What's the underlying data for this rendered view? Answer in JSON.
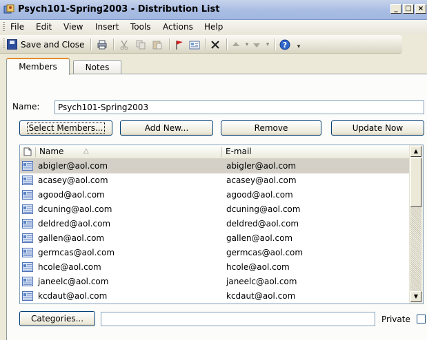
{
  "window": {
    "title": "Psych101-Spring2003 - Distribution List",
    "controls": [
      "_",
      "□",
      "×"
    ]
  },
  "menu": [
    "File",
    "Edit",
    "View",
    "Insert",
    "Tools",
    "Actions",
    "Help"
  ],
  "toolbar": {
    "save_close": "Save and Close",
    "icons": [
      "save-icon",
      "print-icon",
      "cut-icon",
      "copy-icon",
      "paste-icon",
      "flag-icon",
      "address-card-icon",
      "delete-icon",
      "up-arrow-icon",
      "down-arrow-icon",
      "help-icon"
    ]
  },
  "tabs": [
    "Members",
    "Notes"
  ],
  "name_field": {
    "label": "Name:",
    "value": "Psych101-Spring2003"
  },
  "buttons": {
    "select_members": "Select Members...",
    "add_new": "Add New...",
    "remove": "Remove",
    "update_now": "Update Now"
  },
  "list": {
    "columns": [
      "Name",
      "E-mail"
    ],
    "sort_indicator": "△",
    "rows": [
      {
        "name": "abigler@aol.com",
        "email": "abigler@aol.com",
        "selected": true
      },
      {
        "name": "acasey@aol.com",
        "email": "acasey@aol.com"
      },
      {
        "name": "agood@aol.com",
        "email": "agood@aol.com"
      },
      {
        "name": "dcuning@aol.com",
        "email": "dcuning@aol.com"
      },
      {
        "name": "deldred@aol.com",
        "email": "deldred@aol.com"
      },
      {
        "name": "gallen@aol.com",
        "email": "gallen@aol.com"
      },
      {
        "name": "germcas@aol.com",
        "email": "germcas@aol.com"
      },
      {
        "name": "hcole@aol.com",
        "email": "hcole@aol.com"
      },
      {
        "name": "janeelc@aol.com",
        "email": "janeelc@aol.com"
      },
      {
        "name": "kcdaut@aol.com",
        "email": "kcdaut@aol.com"
      }
    ]
  },
  "footer": {
    "categories": "Categories...",
    "categories_value": "",
    "private_label": "Private",
    "private_checked": false
  },
  "colors": {
    "titlebar": "#a9bde3",
    "selected_row": "#d4d0c8",
    "window_bg": "#ece9d8"
  }
}
